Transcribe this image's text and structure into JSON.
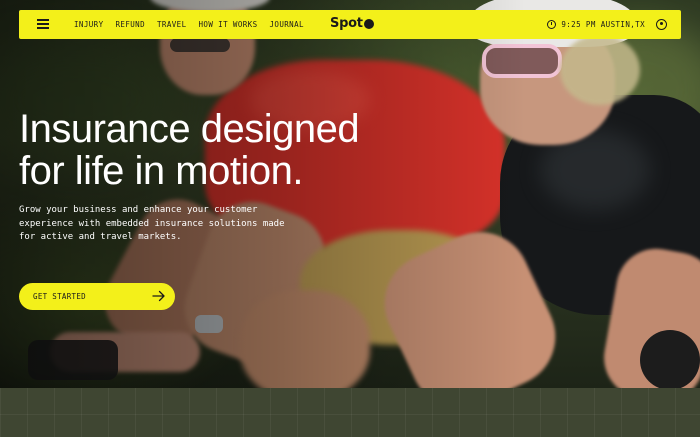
{
  "nav": {
    "links": [
      "INJURY",
      "REFUND",
      "TRAVEL",
      "HOW IT WORKS",
      "JOURNAL"
    ],
    "brand": "Spot",
    "time": "9:25 PM",
    "location": "AUSTIN,TX"
  },
  "hero": {
    "headline_line1": "Insurance designed",
    "headline_line2": "for life in motion.",
    "subcopy": "Grow your business and enhance your customer experience with embedded insurance solutions made for active and travel markets.",
    "cta_label": "GET STARTED"
  },
  "colors": {
    "accent": "#f3f01a",
    "text_dark": "#1a1a1a",
    "strip": "#3f4632"
  },
  "icons": {
    "menu": "hamburger-icon",
    "clock": "clock-icon",
    "account": "user-icon",
    "cta": "arrow-right-icon"
  }
}
